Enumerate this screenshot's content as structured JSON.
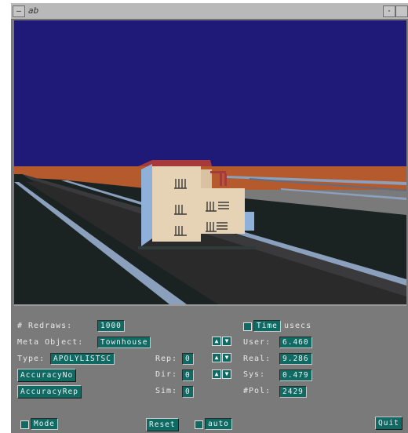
{
  "window": {
    "title_glyph": "ab",
    "menu_button": "—",
    "minimize_glyph": "·",
    "maximize_glyph": ""
  },
  "colors": {
    "sky": "#1f1a78",
    "horizon": "#b45a2c",
    "ground": "#1a2322",
    "road": "#2a2a2b",
    "road_edge": "#8aa0bd",
    "house_wall": "#e6d2b4",
    "roof": "#a63a3a",
    "panel": "#7a7a7a",
    "field": "#0e6a63"
  },
  "panel": {
    "redraws_label": "# Redraws:",
    "redraws_value": "1000",
    "meta_label": "Meta Object:",
    "meta_value": "Townhouse",
    "type_label": "Type:",
    "type_value": "APOLYLISTSC",
    "accuracy_no": "AccuracyNo",
    "accuracy_rep": "AccuracyRep",
    "rep_label": "Rep:",
    "rep_value": "0",
    "dir_label": "Dir:",
    "dir_value": "0",
    "sim_label": "Sim:",
    "sim_value": "0",
    "time_label": "Time",
    "usecs_label": "usecs",
    "user_label": "User:",
    "user_value": "6.460",
    "real_label": "Real:",
    "real_value": "9.286",
    "sys_label": "Sys:",
    "sys_value": "0.479",
    "pol_label": "#Pol:",
    "pol_value": "2429",
    "mode_label": "Mode",
    "reset_label": "Reset",
    "auto_label": "auto",
    "quit_label": "Quit"
  }
}
